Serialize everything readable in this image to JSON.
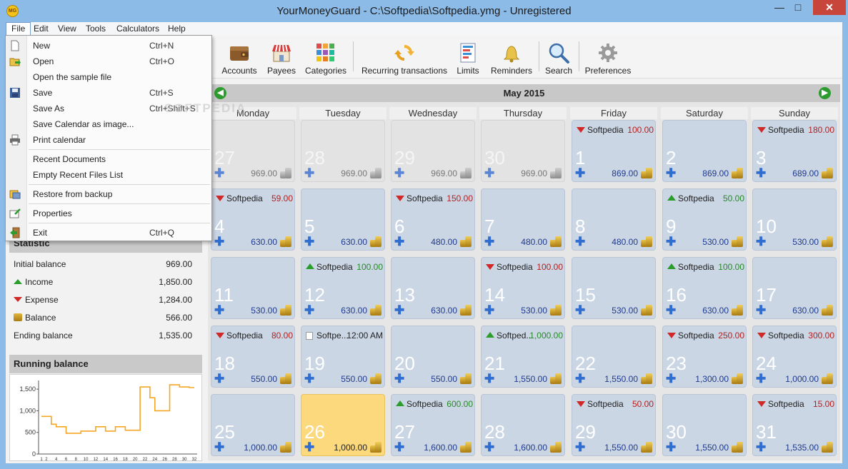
{
  "window": {
    "title": "YourMoneyGuard - C:\\Softpedia\\Softpedia.ymg - Unregistered",
    "app_icon": "MG",
    "minimize": "—",
    "maximize": "□",
    "close": "✕"
  },
  "menubar": {
    "items": [
      "File",
      "Edit",
      "View",
      "Tools",
      "Calculators",
      "Help"
    ],
    "active": "File"
  },
  "toolbar": {
    "accounts": "Accounts",
    "payees": "Payees",
    "categories": "Categories",
    "recurring": "Recurring transactions",
    "limits": "Limits",
    "reminders": "Reminders",
    "search": "Search",
    "preferences": "Preferences"
  },
  "file_menu": {
    "new": "New",
    "new_short": "Ctrl+N",
    "open": "Open",
    "open_short": "Ctrl+O",
    "open_sample": "Open the sample file",
    "save": "Save",
    "save_short": "Ctrl+S",
    "save_as": "Save As",
    "save_as_short": "Ctrl+Shift+S",
    "save_calendar": "Save Calendar as image...",
    "print_calendar": "Print calendar",
    "recent_docs": "Recent Documents",
    "empty_recent": "Empty Recent Files List",
    "restore": "Restore from backup",
    "properties": "Properties",
    "exit": "Exit",
    "exit_short": "Ctrl+Q"
  },
  "statistic": {
    "title": "Statistic",
    "initial_label": "Initial balance",
    "initial_value": "969.00",
    "income_label": "Income",
    "income_value": "1,850.00",
    "expense_label": "Expense",
    "expense_value": "1,284.00",
    "balance_label": "Balance",
    "balance_value": "566.00",
    "ending_label": "Ending balance",
    "ending_value": "1,535.00"
  },
  "running_balance": {
    "title": "Running balance",
    "yticks": [
      "1,500",
      "1,000",
      "500",
      "0"
    ],
    "xticks": [
      "1",
      "2",
      "4",
      "6",
      "8",
      "10",
      "12",
      "14",
      "16",
      "18",
      "20",
      "22",
      "24",
      "26",
      "28",
      "30",
      "32"
    ]
  },
  "chart_data": {
    "type": "line",
    "title": "Running balance",
    "x": [
      1,
      2,
      3,
      4,
      5,
      6,
      7,
      8,
      9,
      10,
      11,
      12,
      13,
      14,
      15,
      16,
      17,
      18,
      19,
      20,
      21,
      22,
      23,
      24,
      25,
      26,
      27,
      28,
      29,
      30,
      31
    ],
    "values": [
      869,
      869,
      689,
      630,
      630,
      480,
      480,
      480,
      530,
      530,
      530,
      630,
      630,
      530,
      530,
      630,
      630,
      550,
      550,
      550,
      1550,
      1550,
      1300,
      1000,
      1000,
      1000,
      1600,
      1600,
      1550,
      1550,
      1535
    ],
    "ylim": [
      0,
      1700
    ],
    "color": "#f5a623"
  },
  "calendar": {
    "month": "May 2015",
    "prev_icon": "arrow-left-icon",
    "next_icon": "arrow-right-icon",
    "weekdays": [
      "Monday",
      "Tuesday",
      "Wednesday",
      "Thursday",
      "Friday",
      "Saturday",
      "Sunday"
    ],
    "weeks": [
      [
        {
          "day": "27",
          "balance": "969.00",
          "kind": "other"
        },
        {
          "day": "28",
          "balance": "969.00",
          "kind": "other"
        },
        {
          "day": "29",
          "balance": "969.00",
          "kind": "other"
        },
        {
          "day": "30",
          "balance": "969.00",
          "kind": "other"
        },
        {
          "day": "1",
          "balance": "869.00",
          "kind": "current",
          "tx": {
            "type": "down",
            "name": "Softpedia",
            "amount": "100.00"
          }
        },
        {
          "day": "2",
          "balance": "869.00",
          "kind": "current"
        },
        {
          "day": "3",
          "balance": "689.00",
          "kind": "current",
          "tx": {
            "type": "down",
            "name": "Softpedia",
            "amount": "180.00"
          }
        }
      ],
      [
        {
          "day": "4",
          "balance": "630.00",
          "kind": "current",
          "tx": {
            "type": "down",
            "name": "Softpedia",
            "amount": "59.00"
          }
        },
        {
          "day": "5",
          "balance": "630.00",
          "kind": "current"
        },
        {
          "day": "6",
          "balance": "480.00",
          "kind": "current",
          "tx": {
            "type": "down",
            "name": "Softpedia",
            "amount": "150.00"
          }
        },
        {
          "day": "7",
          "balance": "480.00",
          "kind": "current"
        },
        {
          "day": "8",
          "balance": "480.00",
          "kind": "current"
        },
        {
          "day": "9",
          "balance": "530.00",
          "kind": "current",
          "tx": {
            "type": "up",
            "name": "Softpedia",
            "amount": "50.00"
          }
        },
        {
          "day": "10",
          "balance": "530.00",
          "kind": "current"
        }
      ],
      [
        {
          "day": "11",
          "balance": "530.00",
          "kind": "current"
        },
        {
          "day": "12",
          "balance": "630.00",
          "kind": "current",
          "tx": {
            "type": "up",
            "name": "Softpedia",
            "amount": "100.00"
          }
        },
        {
          "day": "13",
          "balance": "630.00",
          "kind": "current"
        },
        {
          "day": "14",
          "balance": "530.00",
          "kind": "current",
          "tx": {
            "type": "down",
            "name": "Softpedia",
            "amount": "100.00"
          }
        },
        {
          "day": "15",
          "balance": "530.00",
          "kind": "current"
        },
        {
          "day": "16",
          "balance": "630.00",
          "kind": "current",
          "tx": {
            "type": "up",
            "name": "Softpedia",
            "amount": "100.00"
          }
        },
        {
          "day": "17",
          "balance": "630.00",
          "kind": "current"
        }
      ],
      [
        {
          "day": "18",
          "balance": "550.00",
          "kind": "current",
          "tx": {
            "type": "down",
            "name": "Softpedia",
            "amount": "80.00"
          }
        },
        {
          "day": "19",
          "balance": "550.00",
          "kind": "current",
          "tx": {
            "type": "note",
            "name": "Softpe...",
            "amount": "12:00 AM"
          }
        },
        {
          "day": "20",
          "balance": "550.00",
          "kind": "current"
        },
        {
          "day": "21",
          "balance": "1,550.00",
          "kind": "current",
          "tx": {
            "type": "up",
            "name": "Softped...",
            "amount": "1,000.00"
          }
        },
        {
          "day": "22",
          "balance": "1,550.00",
          "kind": "current"
        },
        {
          "day": "23",
          "balance": "1,300.00",
          "kind": "current",
          "tx": {
            "type": "down",
            "name": "Softpedia",
            "amount": "250.00"
          }
        },
        {
          "day": "24",
          "balance": "1,000.00",
          "kind": "current",
          "tx": {
            "type": "down",
            "name": "Softpedia",
            "amount": "300.00"
          }
        }
      ],
      [
        {
          "day": "25",
          "balance": "1,000.00",
          "kind": "current"
        },
        {
          "day": "26",
          "balance": "1,000.00",
          "kind": "today"
        },
        {
          "day": "27",
          "balance": "1,600.00",
          "kind": "current",
          "tx": {
            "type": "up",
            "name": "Softpedia",
            "amount": "600.00"
          }
        },
        {
          "day": "28",
          "balance": "1,600.00",
          "kind": "current"
        },
        {
          "day": "29",
          "balance": "1,550.00",
          "kind": "current",
          "tx": {
            "type": "down",
            "name": "Softpedia",
            "amount": "50.00"
          }
        },
        {
          "day": "30",
          "balance": "1,550.00",
          "kind": "current"
        },
        {
          "day": "31",
          "balance": "1,535.00",
          "kind": "current",
          "tx": {
            "type": "down",
            "name": "Softpedia",
            "amount": "15.00"
          }
        }
      ]
    ]
  },
  "watermark": "SOFTPEDIA",
  "colors": {
    "expense": "#b32020",
    "income": "#268a26",
    "balance": "#1f3a8a",
    "today": "#fbd97c",
    "cell": "#cbd6e5",
    "chart_line": "#f5a623"
  }
}
